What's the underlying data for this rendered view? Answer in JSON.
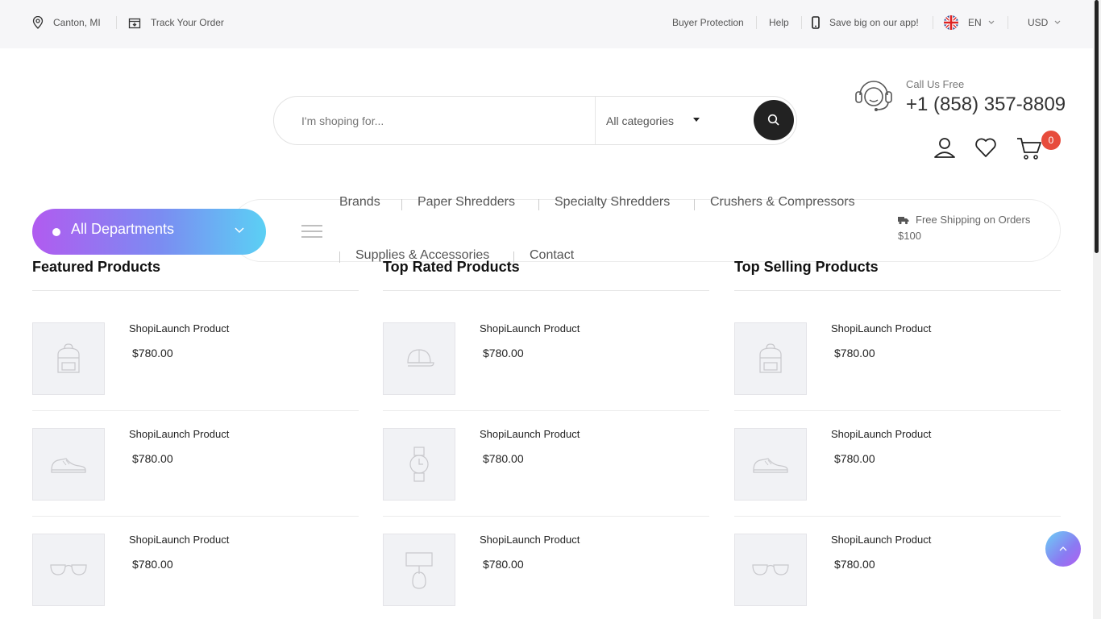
{
  "topbar": {
    "location": "Canton, MI",
    "track_order": "Track Your Order",
    "buyer_protection": "Buyer Protection",
    "help": "Help",
    "app_promo": "Save big on our app!",
    "language": "EN",
    "currency": "USD"
  },
  "search": {
    "placeholder": "I'm shoping for...",
    "category": "All categories"
  },
  "contact": {
    "label": "Call Us Free",
    "phone": "+1 (858) 357-8809"
  },
  "cart": {
    "count": "0"
  },
  "departments": {
    "label": "All Departments"
  },
  "nav": {
    "links": [
      "Brands",
      "Paper Shredders",
      "Specialty Shredders",
      "Crushers & Compressors",
      "Supplies & Accessories",
      "Contact"
    ]
  },
  "shipping": {
    "text": "Free Shipping on Orders $100"
  },
  "columns": [
    {
      "title": "Featured Products",
      "products": [
        {
          "name": "ShopiLaunch Product",
          "price": "$780.00",
          "icon": "backpack-icon"
        },
        {
          "name": "ShopiLaunch Product",
          "price": "$780.00",
          "icon": "sneaker-icon"
        },
        {
          "name": "ShopiLaunch Product",
          "price": "$780.00",
          "icon": "sunglasses-icon"
        }
      ]
    },
    {
      "title": "Top Rated Products",
      "products": [
        {
          "name": "ShopiLaunch Product",
          "price": "$780.00",
          "icon": "cap-icon"
        },
        {
          "name": "ShopiLaunch Product",
          "price": "$780.00",
          "icon": "watch-icon"
        },
        {
          "name": "ShopiLaunch Product",
          "price": "$780.00",
          "icon": "lamp-icon"
        }
      ]
    },
    {
      "title": "Top Selling Products",
      "products": [
        {
          "name": "ShopiLaunch Product",
          "price": "$780.00",
          "icon": "backpack-icon"
        },
        {
          "name": "ShopiLaunch Product",
          "price": "$780.00",
          "icon": "sneaker-icon"
        },
        {
          "name": "ShopiLaunch Product",
          "price": "$780.00",
          "icon": "sunglasses-icon"
        }
      ]
    }
  ],
  "colors": {
    "accent_start": "#b15bf0",
    "accent_end": "#5bd0f4",
    "badge": "#e74c3c"
  }
}
